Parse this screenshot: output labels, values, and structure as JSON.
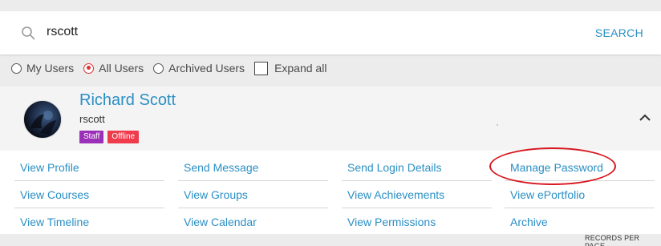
{
  "search": {
    "value": "rscott",
    "button_label": "SEARCH"
  },
  "filters": {
    "radios": [
      {
        "label": "My Users",
        "checked": false
      },
      {
        "label": "All Users",
        "checked": true
      },
      {
        "label": "Archived Users",
        "checked": false
      }
    ],
    "expand_all": {
      "label": "Expand all",
      "checked": false
    }
  },
  "user": {
    "name": "Richard Scott",
    "username": "rscott",
    "badges": [
      "Staff",
      "Offline"
    ]
  },
  "actions": {
    "view_profile": "View Profile",
    "send_message": "Send Message",
    "send_login_details": "Send Login Details",
    "manage_password": "Manage Password",
    "view_courses": "View Courses",
    "view_groups": "View Groups",
    "view_achievements": "View Achievements",
    "view_eportfolio": "View ePortfolio",
    "view_timeline": "View Timeline",
    "view_calendar": "View Calendar",
    "view_permissions": "View Permissions",
    "archive": "Archive"
  },
  "footer": {
    "records_per_page": "RECORDS PER PAGE"
  },
  "colors": {
    "link": "#2a8fc4",
    "staff_badge": "#9b30b8",
    "offline_badge": "#ef3b4c",
    "highlight_ellipse": "#d8161f",
    "radio_selected": "#e0302f"
  }
}
